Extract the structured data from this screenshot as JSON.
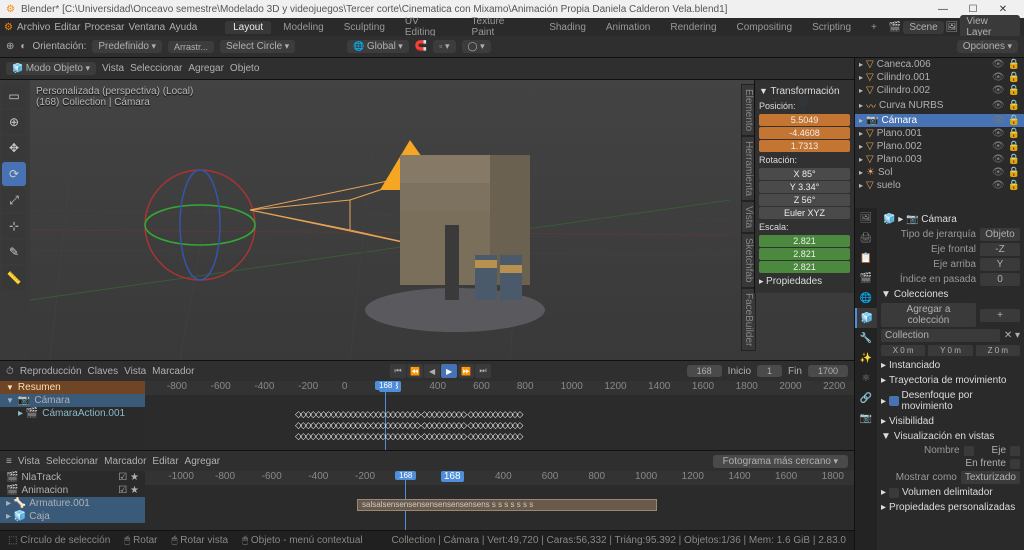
{
  "title": "Blender* [C:\\Universidad\\Onceavo semestre\\Modelado 3D y videojuegos\\Tercer corte\\Cinematica con Mixamo\\Animación Propia Daniela Calderon Vela.blend1]",
  "menu": [
    "Archivo",
    "Editar",
    "Procesar",
    "Ventana",
    "Ayuda"
  ],
  "workspaces": [
    "Layout",
    "Modeling",
    "Sculpting",
    "UV Editing",
    "Texture Paint",
    "Shading",
    "Animation",
    "Rendering",
    "Compositing",
    "Scripting"
  ],
  "scene_label": "Scene",
  "viewlayer_label": "View Layer",
  "hdr2": {
    "orient": "Orientación:",
    "predef": "Predefinido",
    "arrastre": "Arrastr...",
    "select": "Select Circle",
    "global": "Global",
    "opciones": "Opciones"
  },
  "hdr3": {
    "mode": "Modo Objeto",
    "items": [
      "Vista",
      "Seleccionar",
      "Agregar",
      "Objeto"
    ]
  },
  "vp_overlay": [
    "Personalizada (perspectiva) (Local)",
    "(168) Collection | Cámara"
  ],
  "transform": {
    "hdr": "Transformación",
    "pos_lbl": "Posición:",
    "pos": [
      "5.5049",
      "-4.4608",
      "1.7313"
    ],
    "rot_lbl": "Rotación:",
    "rot": [
      "X   85°",
      "Y 3.34°",
      "Z   56°"
    ],
    "euler": "Euler XYZ",
    "scale_lbl": "Escala:",
    "scale": [
      "2.821",
      "2.821",
      "2.821"
    ],
    "props": "Propiedades"
  },
  "n_tabs": [
    "Elemento",
    "Herramienta",
    "Vista",
    "Sketchfab",
    "FaceBuilder"
  ],
  "timeline": {
    "menu": [
      "Reproducción",
      "Claves",
      "Vista",
      "Marcador"
    ],
    "cur": "168",
    "start_lbl": "Inicio",
    "start": "1",
    "end_lbl": "Fin",
    "end": "1700",
    "ticks": [
      -800,
      -600,
      -400,
      -200,
      0,
      168,
      400,
      600,
      800,
      1000,
      1200,
      1400,
      1600,
      1800,
      2000,
      2200
    ],
    "tree": {
      "summary": "Resumen",
      "item1": "Cámara",
      "item2": "CámaraAction.001"
    }
  },
  "nla": {
    "menu": [
      "Vista",
      "Seleccionar",
      "Marcador",
      "Editar",
      "Agregar"
    ],
    "snap": "Fotograma más cercano",
    "ticks": [
      -1000,
      -800,
      -600,
      -400,
      -200,
      0,
      168,
      400,
      600,
      800,
      1000,
      1200,
      1400,
      1600,
      1800
    ],
    "tracks": [
      "NlaTrack",
      "Animacion",
      "Armature.001",
      "Caja"
    ],
    "strip_text": "salsalsensensensensensensensens s s s s s s s stcelebcelebcelebcelebcelebceleb  celeb"
  },
  "status": {
    "l1": "Círculo de selección",
    "l2": "Rotar",
    "l3": "Rotar vista",
    "l4": "Objeto - menú contextual",
    "r": "Collection | Cámara | Vert:49,720 | Caras:56,332 | Triáng:95.392 | Objetos:1/36 | Mem: 1.6 GiB | 2.83.0"
  },
  "outliner": [
    {
      "name": "Caneca.006",
      "icon": "▽"
    },
    {
      "name": "Cilindro.001",
      "icon": "▽"
    },
    {
      "name": "Cilindro.002",
      "icon": "▽"
    },
    {
      "name": "Curva NURBS",
      "icon": "〰"
    },
    {
      "name": "Cámara",
      "icon": "📷",
      "sel": true
    },
    {
      "name": "Plano.001",
      "icon": "▽"
    },
    {
      "name": "Plano.002",
      "icon": "▽"
    },
    {
      "name": "Plano.003",
      "icon": "▽"
    },
    {
      "name": "Sol",
      "icon": "☀"
    },
    {
      "name": "suelo",
      "icon": "▽"
    }
  ],
  "props": {
    "breadcrumb": "Cámara",
    "hier_lbl": "Tipo de jerarquía",
    "hier_val": "Objeto",
    "axis1_lbl": "Eje frontal",
    "axis1_val": "-Z",
    "axis2_lbl": "Eje arriba",
    "axis2_val": "Y",
    "index_lbl": "Índice en pasada",
    "index_val": "0",
    "collections": "Colecciones",
    "add_coll": "Agregar a colección",
    "coll_name": "Collection",
    "xyz": [
      "X  0 m",
      "Y  0 m",
      "Z  0 m"
    ],
    "inst": "Instanciado",
    "traj": "Trayectoria de movimiento",
    "motion_blur": "Desenfoque por movimiento",
    "visib": "Visibilidad",
    "vis_views": "Visualización en vistas",
    "nombre": "Nombre",
    "eje": "Eje",
    "enfrente": "En frente",
    "mostrar": "Mostrar como",
    "texturizado": "Texturizado",
    "vol": "Volumen delimitador",
    "custom": "Propiedades personalizadas"
  }
}
